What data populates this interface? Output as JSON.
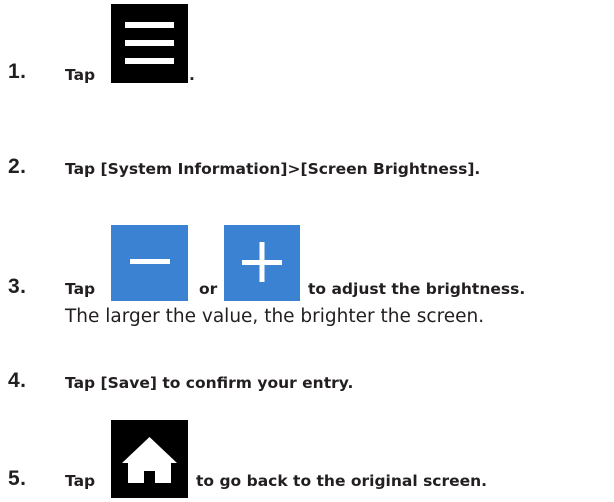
{
  "steps": [
    {
      "number": "1.",
      "text_before": "Tap",
      "icon": "menu-icon",
      "text_after": "."
    },
    {
      "number": "2.",
      "text": "Tap [System Information]>[Screen Brightness]."
    },
    {
      "number": "3.",
      "text_before": "Tap",
      "icon_1": "minus-icon",
      "text_between": "or",
      "icon_2": "plus-icon",
      "text_after": "to adjust the brightness.",
      "note": "The larger the value, the brighter the screen."
    },
    {
      "number": "4.",
      "text": "Tap [Save] to confirm your entry."
    },
    {
      "number": "5.",
      "text_before": "Tap",
      "icon": "home-icon",
      "text_after": "to go back to the original screen."
    }
  ],
  "colors": {
    "text": "#231f20",
    "icon_dark": "#000000",
    "icon_blue": "#3c82d2"
  }
}
